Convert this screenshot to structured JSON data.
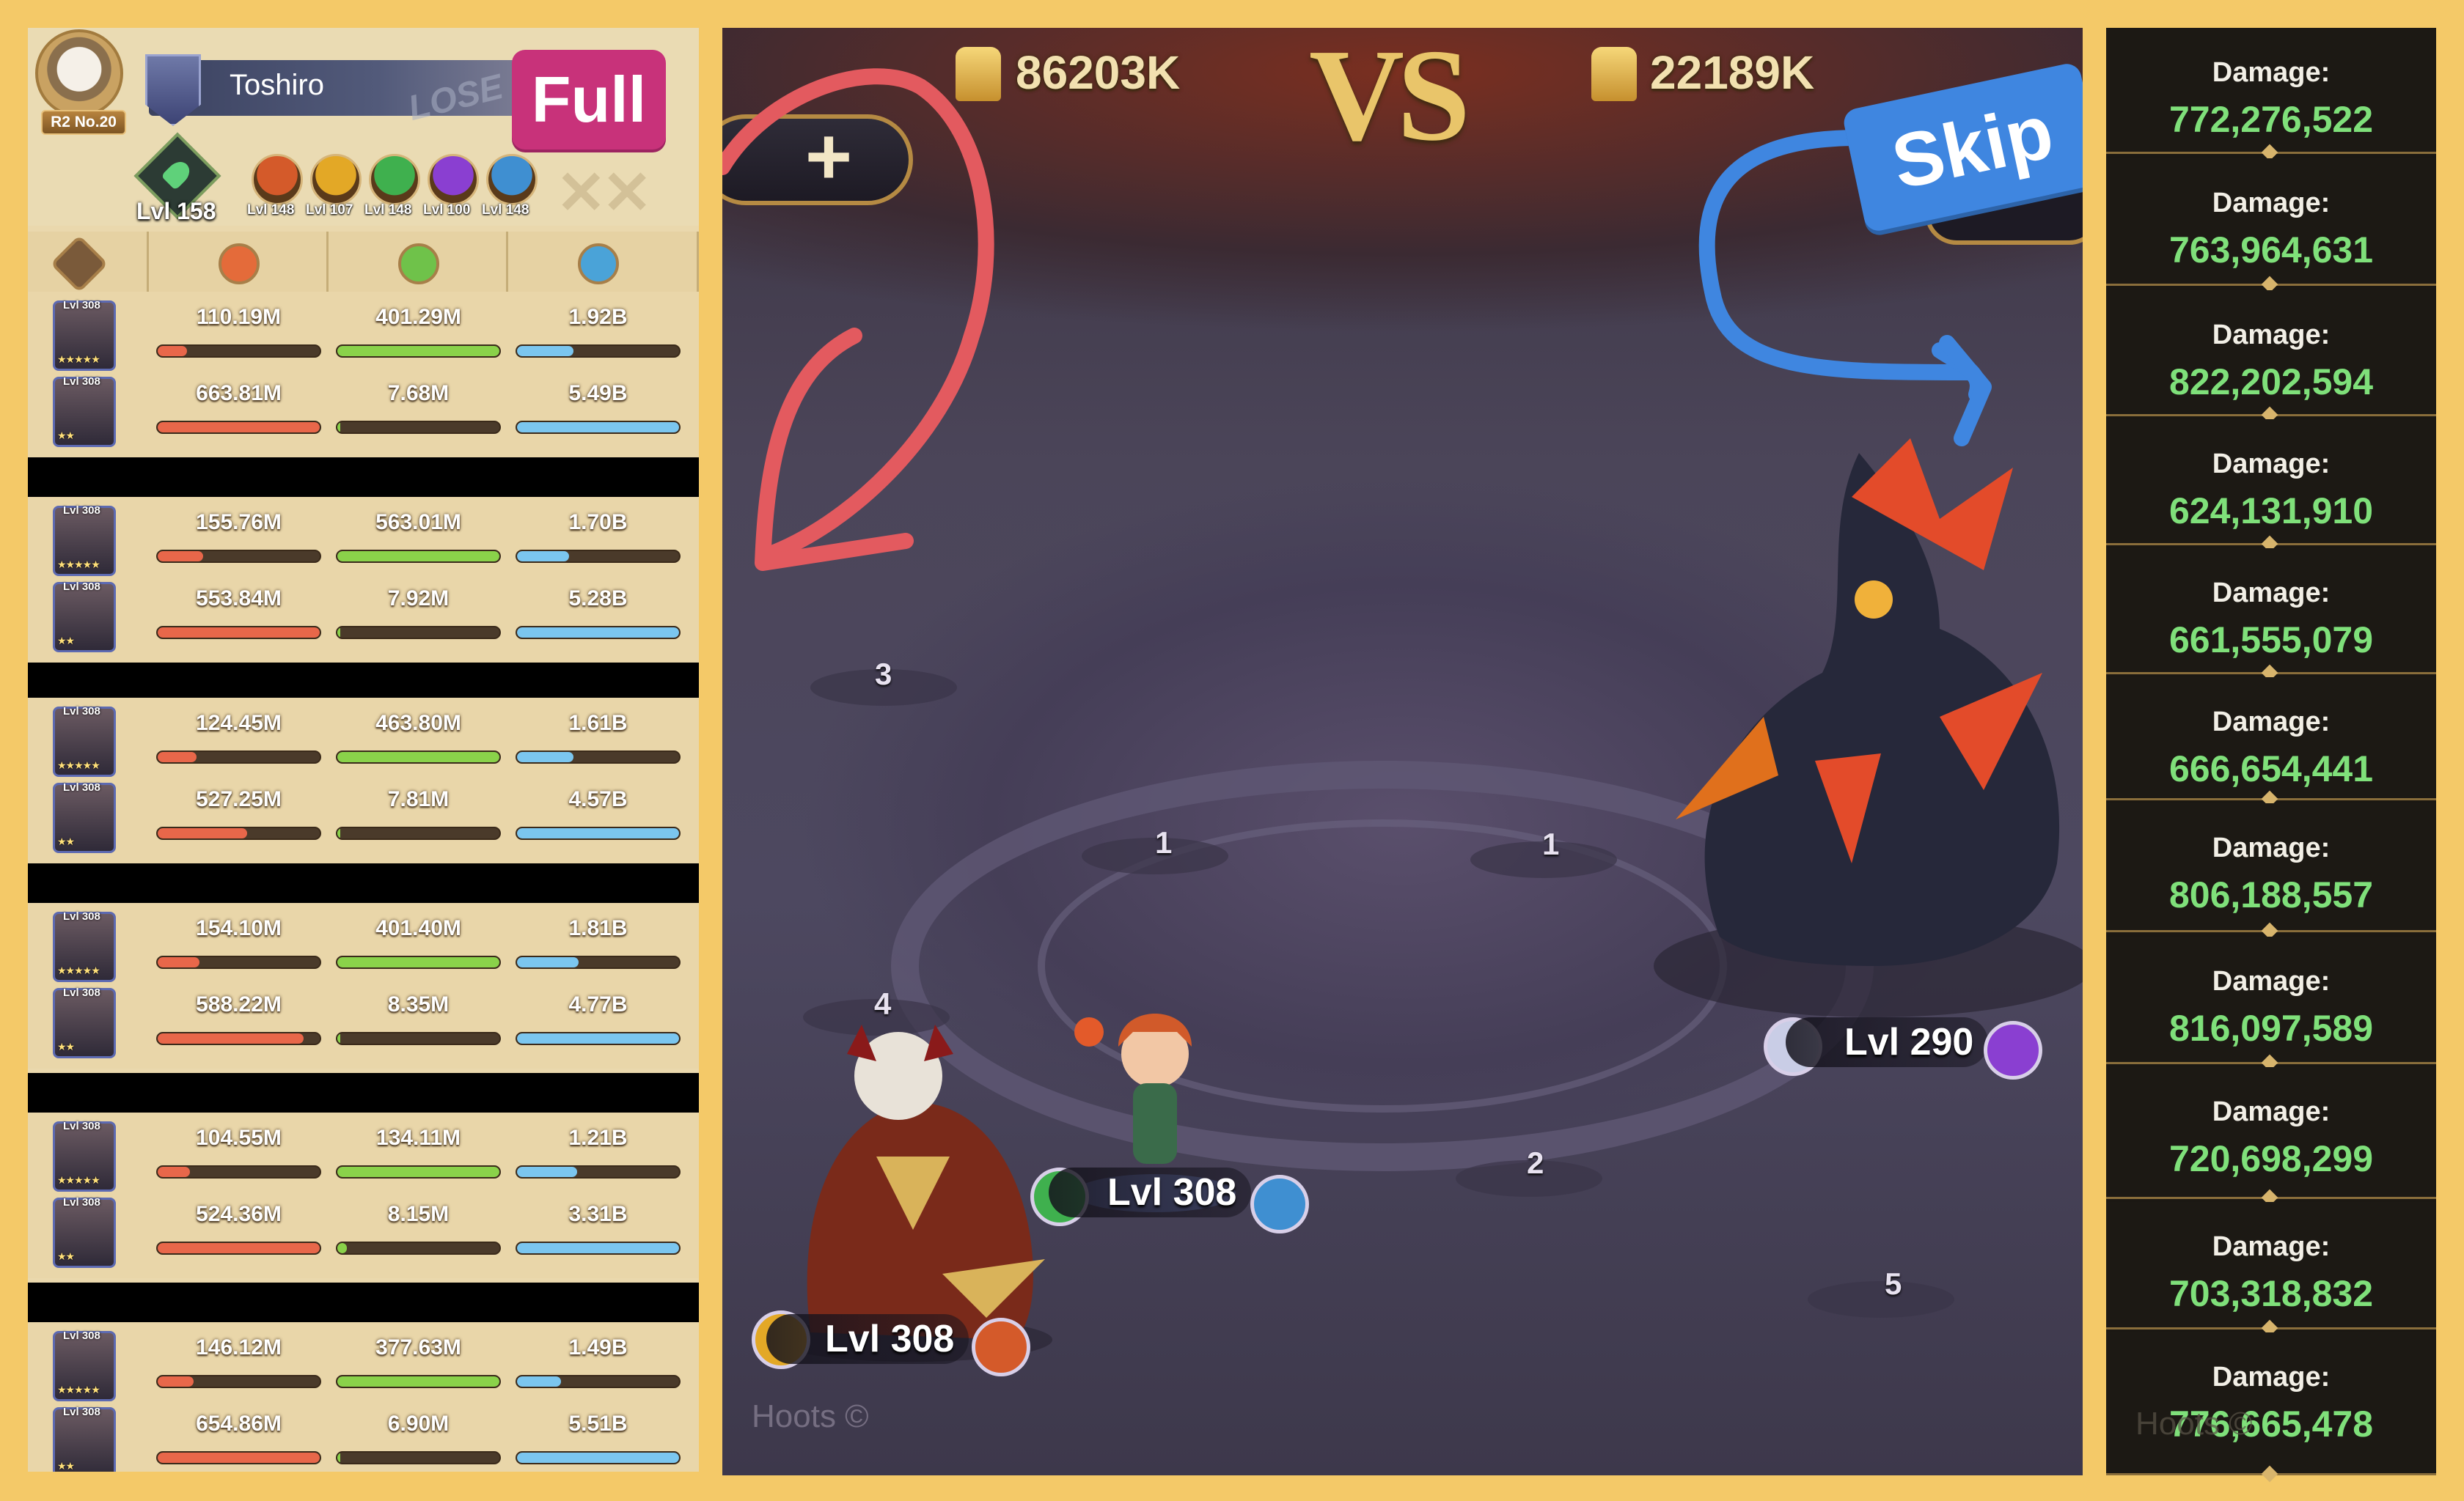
{
  "player": {
    "name": "Toshiro",
    "rank": "R2 No.20",
    "result_watermark": "LOSE",
    "full_button": "Full",
    "main_level": "Lvl 158",
    "artifacts": [
      {
        "level": "Lvl 148",
        "color": "#d45a2a"
      },
      {
        "level": "Lvl 107",
        "color": "#e3a826"
      },
      {
        "level": "Lvl 148",
        "color": "#3fb04e"
      },
      {
        "level": "Lvl 100",
        "color": "#8a3fd1"
      },
      {
        "level": "Lvl 148",
        "color": "#3f8fd1"
      }
    ],
    "columns": [
      {
        "icon": "damage-dealt-icon",
        "color": "#e46b3a"
      },
      {
        "icon": "healing-icon",
        "color": "#6fc24a"
      },
      {
        "icon": "damage-taken-icon",
        "color": "#4aa3d8"
      }
    ]
  },
  "teams": [
    {
      "members": [
        {
          "level": "Lvl 308",
          "stars": "★★★★★",
          "damage": "110.19M",
          "heal": "401.29M",
          "taken": "1.92B",
          "damage_fill": 0.18,
          "heal_fill": 1.0,
          "taken_fill": 0.35
        },
        {
          "level": "Lvl 308",
          "stars": "★★",
          "damage": "663.81M",
          "heal": "7.68M",
          "taken": "5.49B",
          "damage_fill": 1.0,
          "heal_fill": 0.02,
          "taken_fill": 1.0
        }
      ]
    },
    {
      "members": [
        {
          "level": "Lvl 308",
          "stars": "★★★★★",
          "damage": "155.76M",
          "heal": "563.01M",
          "taken": "1.70B",
          "damage_fill": 0.28,
          "heal_fill": 1.0,
          "taken_fill": 0.32
        },
        {
          "level": "Lvl 308",
          "stars": "★★",
          "damage": "553.84M",
          "heal": "7.92M",
          "taken": "5.28B",
          "damage_fill": 1.0,
          "heal_fill": 0.02,
          "taken_fill": 1.0
        }
      ]
    },
    {
      "members": [
        {
          "level": "Lvl 308",
          "stars": "★★★★★",
          "damage": "124.45M",
          "heal": "463.80M",
          "taken": "1.61B",
          "damage_fill": 0.24,
          "heal_fill": 1.0,
          "taken_fill": 0.35
        },
        {
          "level": "Lvl 308",
          "stars": "★★",
          "damage": "527.25M",
          "heal": "7.81M",
          "taken": "4.57B",
          "damage_fill": 0.55,
          "heal_fill": 0.02,
          "taken_fill": 1.0
        }
      ]
    },
    {
      "members": [
        {
          "level": "Lvl 308",
          "stars": "★★★★★",
          "damage": "154.10M",
          "heal": "401.40M",
          "taken": "1.81B",
          "damage_fill": 0.26,
          "heal_fill": 1.0,
          "taken_fill": 0.38
        },
        {
          "level": "Lvl 308",
          "stars": "★★",
          "damage": "588.22M",
          "heal": "8.35M",
          "taken": "4.77B",
          "damage_fill": 0.9,
          "heal_fill": 0.02,
          "taken_fill": 1.0
        }
      ]
    },
    {
      "members": [
        {
          "level": "Lvl 308",
          "stars": "★★★★★",
          "damage": "104.55M",
          "heal": "134.11M",
          "taken": "1.21B",
          "damage_fill": 0.2,
          "heal_fill": 1.0,
          "taken_fill": 0.37
        },
        {
          "level": "Lvl 308",
          "stars": "★★",
          "damage": "524.36M",
          "heal": "8.15M",
          "taken": "3.31B",
          "damage_fill": 1.0,
          "heal_fill": 0.06,
          "taken_fill": 1.0
        }
      ]
    },
    {
      "members": [
        {
          "level": "Lvl 308",
          "stars": "★★★★★",
          "damage": "146.12M",
          "heal": "377.63M",
          "taken": "1.49B",
          "damage_fill": 0.22,
          "heal_fill": 1.0,
          "taken_fill": 0.27
        },
        {
          "level": "Lvl 308",
          "stars": "★★",
          "damage": "654.86M",
          "heal": "6.90M",
          "taken": "5.51B",
          "damage_fill": 1.0,
          "heal_fill": 0.02,
          "taken_fill": 1.0
        }
      ]
    }
  ],
  "battle": {
    "left_power": "86203K",
    "vs": "VS",
    "right_power": "22189K",
    "add_button": "+",
    "skip_button": "Skip",
    "slots": [
      "3",
      "1",
      "4",
      "1",
      "2",
      "5"
    ],
    "hero_levels": [
      "Lvl 308",
      "Lvl 308"
    ],
    "boss_level": "Lvl 290",
    "watermark": "Hoots ©"
  },
  "damage_log": {
    "label": "Damage:",
    "values": [
      "772,276,522",
      "763,964,631",
      "822,202,594",
      "624,131,910",
      "661,555,079",
      "666,654,441",
      "806,188,557",
      "816,097,589",
      "720,698,299",
      "703,318,832",
      "776,665,478"
    ],
    "watermark": "Hoots ©"
  }
}
